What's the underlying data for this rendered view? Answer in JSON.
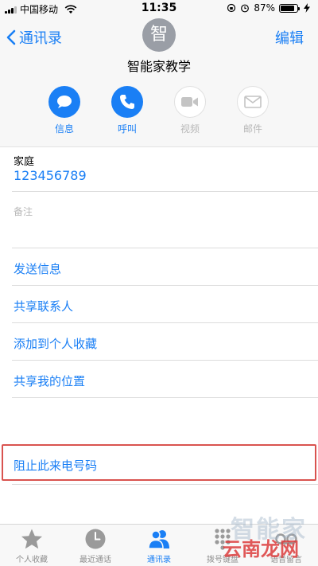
{
  "status_bar": {
    "carrier": "中国移动",
    "time": "11:35",
    "battery_pct": "87%",
    "battery_level": 0.87
  },
  "nav": {
    "back_label": "通讯录",
    "edit_label": "编辑"
  },
  "contact": {
    "avatar_initial": "智",
    "name": "智能家教学"
  },
  "actions": [
    {
      "label": "信息",
      "icon": "message-icon",
      "enabled": true
    },
    {
      "label": "呼叫",
      "icon": "phone-icon",
      "enabled": true
    },
    {
      "label": "视频",
      "icon": "video-icon",
      "enabled": false
    },
    {
      "label": "邮件",
      "icon": "mail-icon",
      "enabled": false
    }
  ],
  "details": {
    "phone_label": "家庭",
    "phone_number": "123456789",
    "notes_label": "备注"
  },
  "options": [
    "发送信息",
    "共享联系人",
    "添加到个人收藏",
    "共享我的位置"
  ],
  "block_label": "阻止此来电号码",
  "tabs": [
    {
      "label": "个人收藏",
      "icon": "star-icon",
      "active": false
    },
    {
      "label": "最近通话",
      "icon": "clock-icon",
      "active": false
    },
    {
      "label": "通讯录",
      "icon": "contacts-icon",
      "active": true
    },
    {
      "label": "拨号键盘",
      "icon": "keypad-icon",
      "active": false
    },
    {
      "label": "语音留言",
      "icon": "voicemail-icon",
      "active": false
    }
  ],
  "watermark": {
    "line1": "智能家",
    "line2": "云南龙网"
  },
  "colors": {
    "accent": "#1a7ff5",
    "highlight_border": "#d9534f"
  }
}
